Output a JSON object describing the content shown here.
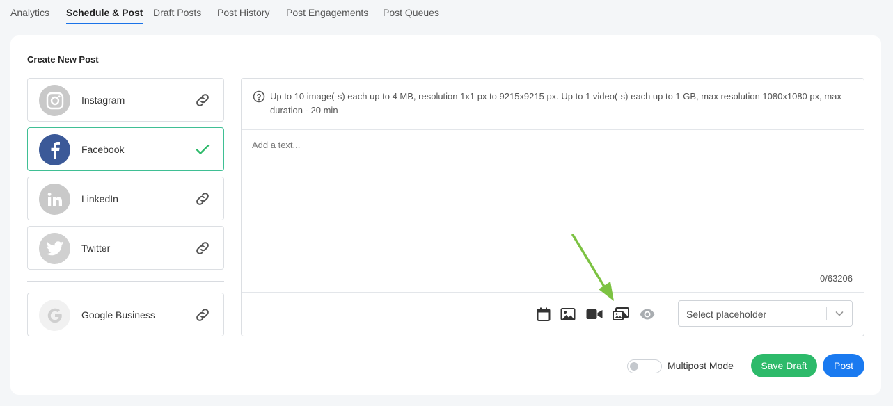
{
  "tabs": [
    {
      "label": "Analytics",
      "active": false
    },
    {
      "label": "Schedule & Post",
      "active": true
    },
    {
      "label": "Draft Posts",
      "active": false
    },
    {
      "label": "Post History",
      "active": false
    },
    {
      "label": "Post Engagements",
      "active": false
    },
    {
      "label": "Post Queues",
      "active": false
    }
  ],
  "create": {
    "title": "Create New Post",
    "accounts": [
      {
        "name": "Instagram",
        "icon": "instagram-icon",
        "selected": false
      },
      {
        "name": "Facebook",
        "icon": "facebook-icon",
        "selected": true
      },
      {
        "name": "LinkedIn",
        "icon": "linkedin-icon",
        "selected": false
      },
      {
        "name": "Twitter",
        "icon": "twitter-icon",
        "selected": false
      },
      {
        "name": "Google Business",
        "icon": "google-icon",
        "selected": false
      }
    ]
  },
  "editor": {
    "info": "Up to 10 image(-s) each up to 4 MB, resolution 1x1 px to 9215x9215 px. Up to 1 video(-s) each up to 1 GB, max resolution 1080x1080 px, max duration - 20 min",
    "placeholder": "Add a text...",
    "counter": "0/63206",
    "tools": [
      "calendar-icon",
      "image-icon",
      "video-icon",
      "gallery-icon",
      "preview-eye-icon"
    ],
    "select_placeholder": "Select placeholder"
  },
  "footer": {
    "multipost_label": "Multipost Mode",
    "multipost_on": false,
    "save_draft": "Save Draft",
    "post": "Post"
  },
  "colors": {
    "accent_blue": "#1a7af0",
    "green": "#2dba6a",
    "selected_border": "#3fbf94",
    "facebook": "#3b5998",
    "annotation_arrow": "#7cc242"
  }
}
